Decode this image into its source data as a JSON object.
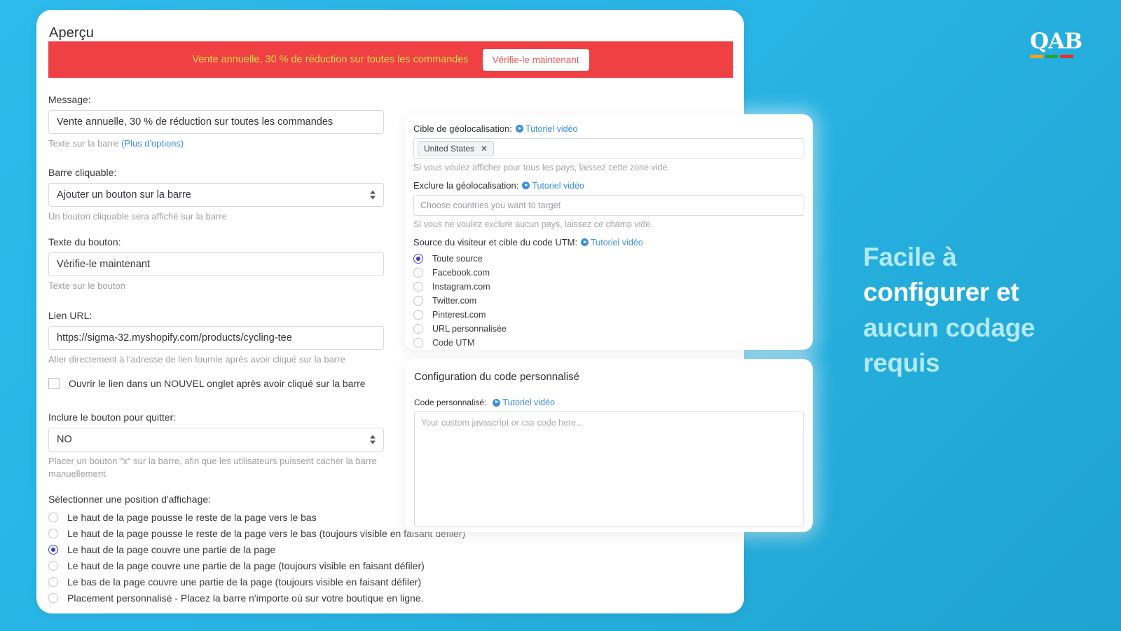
{
  "theme": {
    "bg_start": "#2cbbea",
    "bg_end": "#1fa3d0",
    "banner_bg": "#ef4044",
    "banner_text_color": "#ffd94a",
    "accent_link": "#3a8ede",
    "radio_selected": "#3c3cd2"
  },
  "panel": {
    "title": "Aperçu"
  },
  "preview_bar": {
    "message": "Vente annuelle, 30 % de réduction sur toutes les commandes",
    "button_label": "Vérifie-le maintenant"
  },
  "form": {
    "message": {
      "label": "Message:",
      "value": "Vente annuelle, 30 % de réduction sur toutes les commandes",
      "help": "Texte sur la barre",
      "help_link": "(Plus d'options)"
    },
    "clickable_bar": {
      "label": "Barre cliquable:",
      "value": "Ajouter un bouton sur la barre",
      "help": "Un bouton cliquable sera affiché sur la barre"
    },
    "button_text": {
      "label": "Texte du bouton:",
      "value": "Vérifie-le maintenant",
      "help": "Texte sur le bouton"
    },
    "url": {
      "label": "Lien URL:",
      "value": "https://sigma-32.myshopify.com/products/cycling-tee",
      "help": "Aller directement à l'adresse de lien fournie après avoir cliqué sur la barre"
    },
    "new_tab_checkbox": {
      "label": "Ouvrir le lien dans un NOUVEL onglet après avoir cliqué sur la barre",
      "checked": false
    },
    "close_button": {
      "label": "Inclure le bouton pour quitter:",
      "value": "NO",
      "help": "Placer un bouton \"x\" sur la barre, afin que les utilisateurs puissent cacher la barre manuellement"
    },
    "position": {
      "label": "Sélectionner une position d'affichage:",
      "selected_index": 2,
      "options": [
        "Le haut de la page pousse le reste de la page vers le bas",
        "Le haut de la page pousse le reste de la page vers le bas (toujours visible en faisant défiler)",
        "Le haut de la page couvre une partie de la page",
        "Le haut de la page couvre une partie de la page (toujours visible en faisant défiler)",
        "Le bas de la page couvre une partie de la page (toujours visible en faisant défiler)",
        "Placement personnalisé - Placez la barre n'importe où sur votre boutique en ligne."
      ]
    }
  },
  "geo_panel": {
    "target": {
      "label": "Cible de géolocalisation:",
      "tutorial_link": "Tutoriel vidéo",
      "tag": "United States",
      "tag_remove": "✕",
      "help": "Si vous voulez afficher pour tous les pays, laissez cette zone vide."
    },
    "exclude": {
      "label": "Exclure la géolocalisation:",
      "tutorial_link": "Tutoriel vidéo",
      "placeholder": "Choose countries you want to target",
      "help": "Si vous ne voulez exclure aucun pays, laissez ce champ vide."
    },
    "utm": {
      "label": "Source du visiteur et cible du code UTM:",
      "tutorial_link": "Tutoriel vidéo",
      "selected_index": 0,
      "options": [
        "Toute source",
        "Facebook.com",
        "Instagram.com",
        "Twitter.com",
        "Pinterest.com",
        "URL personnalisée",
        "Code UTM"
      ]
    }
  },
  "code_panel": {
    "title": "Configuration du code personnalisé",
    "field_label": "Code personnalisé:",
    "tutorial_link": "Tutoriel vidéo",
    "placeholder": "Your custom javascript or css code here..."
  },
  "branding": {
    "logo_text": "QAB",
    "logo_bar_colors": [
      "#f0a11e",
      "#2f9e42",
      "#e0342c"
    ],
    "headline_lines": [
      "Facile à",
      "configurer et",
      "aucun codage",
      "requis"
    ]
  }
}
